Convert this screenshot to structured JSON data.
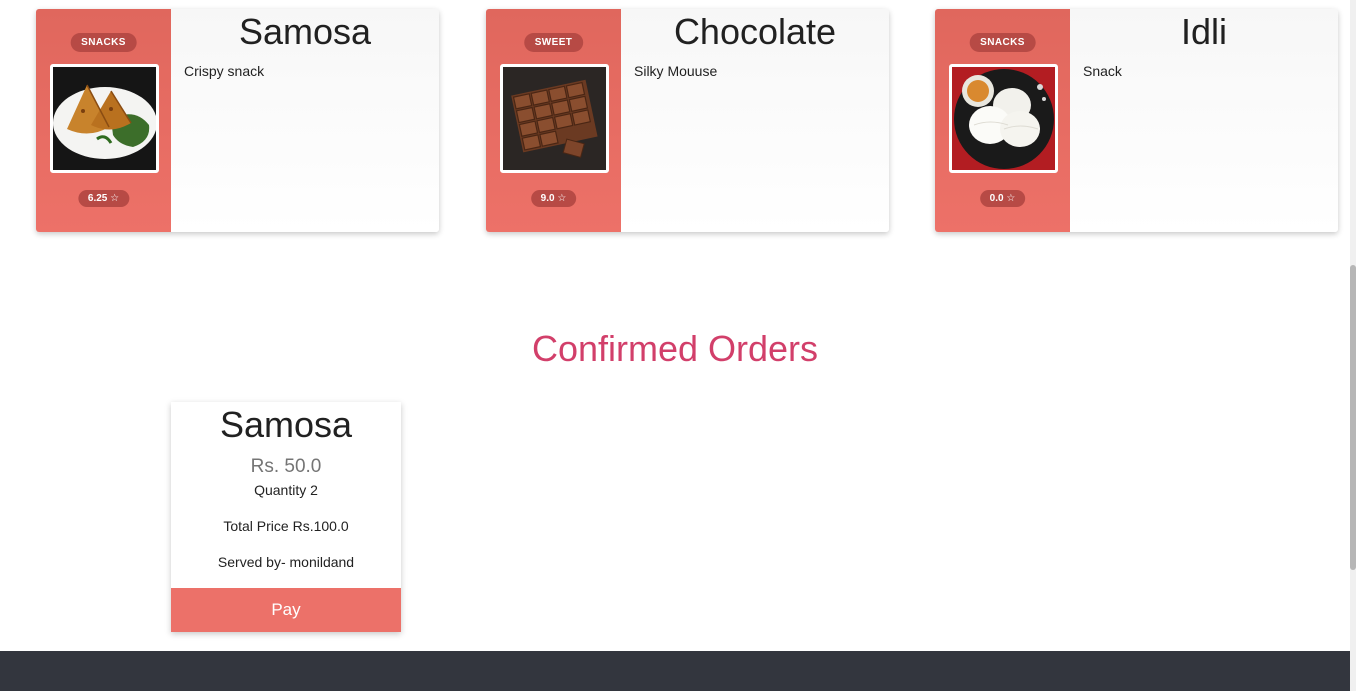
{
  "menu": {
    "items": [
      {
        "name": "Samosa",
        "category": "SNACKS",
        "description": "Crispy snack",
        "rating": "6.25 ☆"
      },
      {
        "name": "Chocolate",
        "category": "SWEET",
        "description": "Silky Mouuse",
        "rating": "9.0 ☆"
      },
      {
        "name": "Idli",
        "category": "SNACKS",
        "description": "Snack",
        "rating": "0.0 ☆"
      }
    ]
  },
  "orders": {
    "title": "Confirmed Orders",
    "items": [
      {
        "name": "Samosa",
        "price": "Rs. 50.0",
        "quantity": "Quantity 2",
        "total": "Total Price Rs.100.0",
        "served_by": "Served by- monildand",
        "pay_label": "Pay"
      }
    ]
  },
  "colors": {
    "card_side": "#ed7168",
    "badge": "#b74a45",
    "section_title": "#d23f6a",
    "footer": "#33363e",
    "pay_button": "#ec7169"
  },
  "icons": [
    "samosa-image",
    "chocolate-image",
    "idli-image",
    "star-icon"
  ]
}
